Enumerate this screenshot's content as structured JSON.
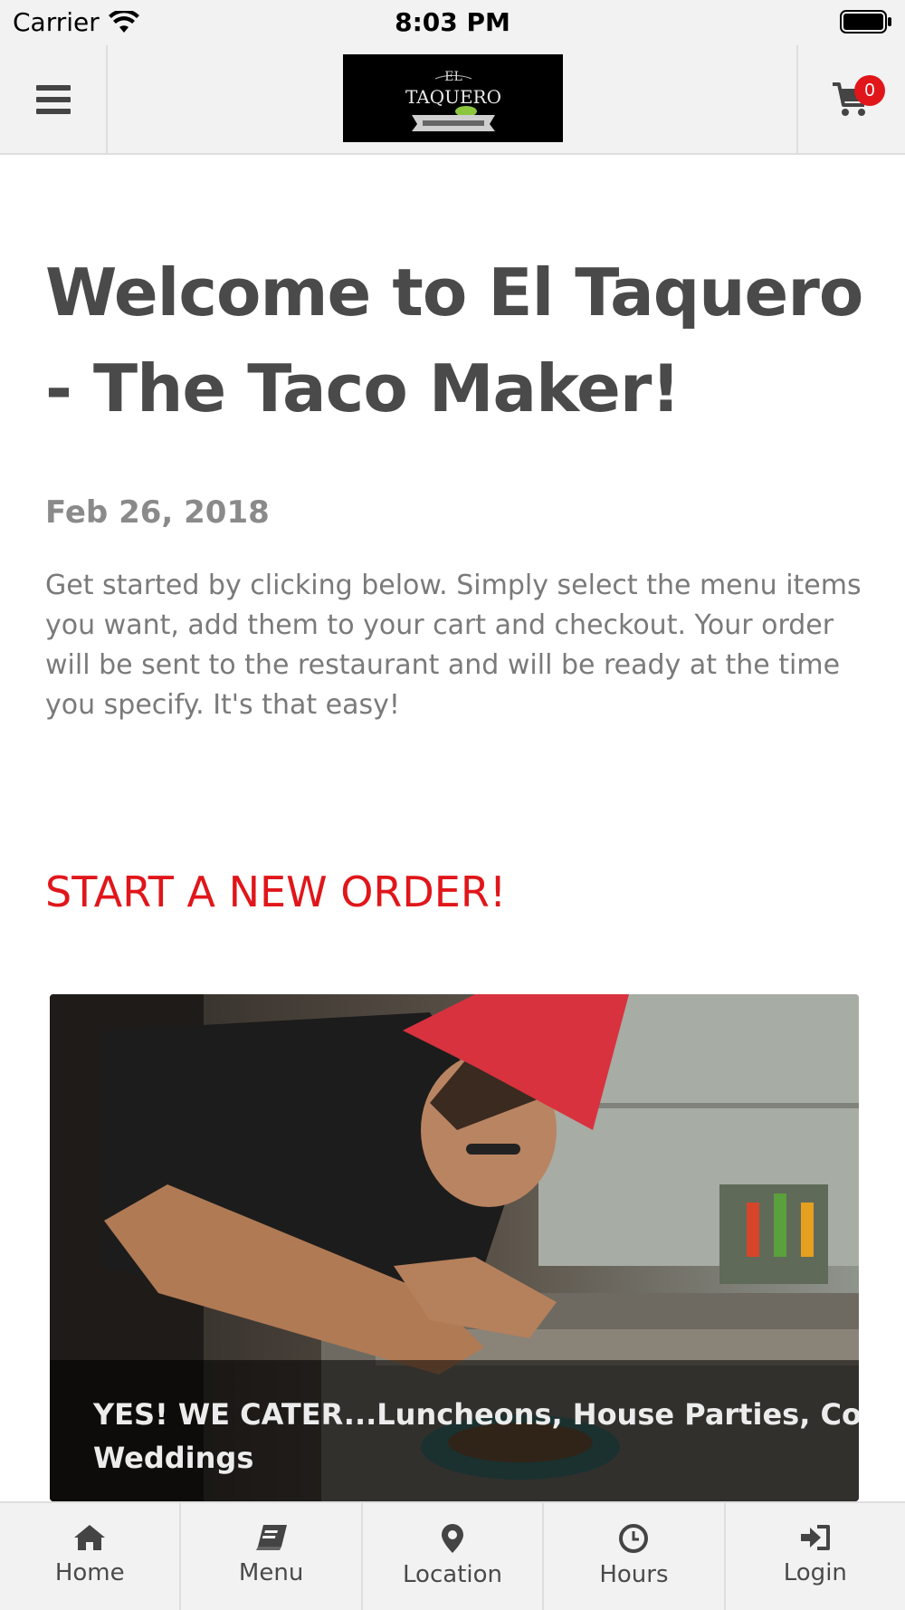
{
  "status_bar": {
    "carrier": "Carrier",
    "time": "8:03 PM",
    "icons": [
      "wifi-icon",
      "battery-icon"
    ]
  },
  "header": {
    "menu_icon": "hamburger-menu-icon",
    "logo_text_top": "EL",
    "logo_text_main": "TAQUERO",
    "cart_icon": "shopping-cart-icon",
    "cart_count": "0"
  },
  "main": {
    "title": "Welcome to El Taquero - The Taco Maker!",
    "date": "Feb 26, 2018",
    "intro": "Get started by clicking below. Simply select the menu items you want, add them to your cart and checkout. Your order will be sent to the restaurant and will be ready at the time you specify. It's that easy!",
    "cta": "START A NEW ORDER!",
    "promo_caption": "YES! WE CATER...Luncheons, House Parties, Corporate Minglers, Weddings"
  },
  "tabs": [
    {
      "label": "Home",
      "icon": "home-icon"
    },
    {
      "label": "Menu",
      "icon": "book-icon"
    },
    {
      "label": "Location",
      "icon": "map-pin-icon"
    },
    {
      "label": "Hours",
      "icon": "clock-icon"
    },
    {
      "label": "Login",
      "icon": "sign-in-icon"
    }
  ],
  "colors": {
    "accent": "#e0161a",
    "header_bg": "#f2f2f2",
    "title": "#4a4a4a",
    "body_text": "#7a7a7a"
  }
}
